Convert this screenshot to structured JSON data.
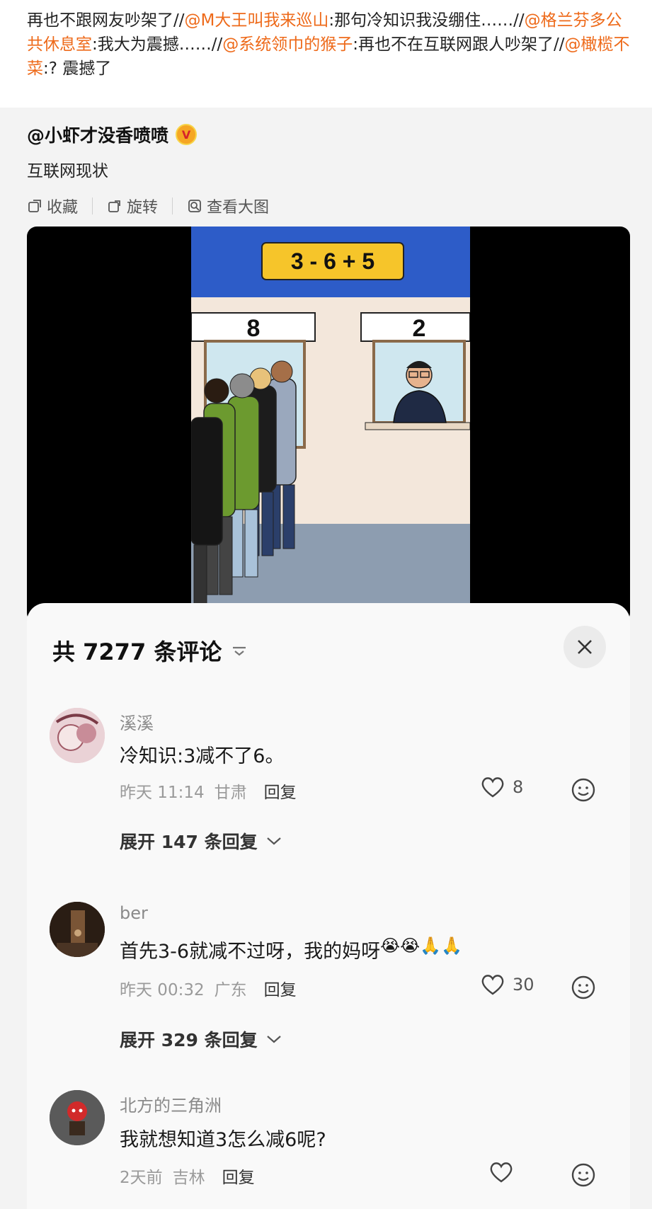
{
  "repost": {
    "parts": [
      {
        "text": "再也不跟网友吵架了//",
        "mention": false
      },
      {
        "text": "@M大王叫我来巡山",
        "mention": true
      },
      {
        "text": ":那句冷知识我没绷住……//",
        "mention": false
      },
      {
        "text": "@格兰芬多公共休息室",
        "mention": true
      },
      {
        "text": ":我大为震撼……//",
        "mention": false
      },
      {
        "text": "@系统领巾的猴子",
        "mention": true
      },
      {
        "text": ":再也不在互联网跟人吵架了//",
        "mention": false
      },
      {
        "text": "@橄榄不菜",
        "mention": true
      },
      {
        "text": ":? 震撼了",
        "mention": false
      }
    ]
  },
  "original": {
    "author": "@小虾才没香喷喷",
    "badge": "V",
    "text": "互联网现状",
    "toolbar": {
      "favorite": "收藏",
      "rotate": "旋转",
      "view_large": "查看大图"
    }
  },
  "image": {
    "equation": "3 - 6 + 5",
    "window_left": "8",
    "window_right": "2"
  },
  "comments_sheet": {
    "title": "共 7277 条评论",
    "comments": [
      {
        "user": "溪溪",
        "text": "冷知识:3减不了6。",
        "time": "昨天 11:14",
        "location": "甘肃",
        "reply": "回复",
        "likes": "8",
        "expand": "展开 147 条回复"
      },
      {
        "user": "ber",
        "text": "首先3-6就减不过呀，我的妈呀",
        "emojis": "😭😭🙏🙏",
        "time": "昨天 00:32",
        "location": "广东",
        "reply": "回复",
        "likes": "30",
        "expand": "展开 329 条回复"
      },
      {
        "user": "北方的三角洲",
        "text": "我就想知道3怎么减6呢?",
        "time": "2天前",
        "location": "吉林",
        "reply": "回复",
        "likes": ""
      }
    ]
  },
  "colors": {
    "mention": "#ee6a1a",
    "badge": "#f5a623",
    "sign_blue": "#2d5cc8",
    "sign_yellow": "#f6c52a"
  }
}
